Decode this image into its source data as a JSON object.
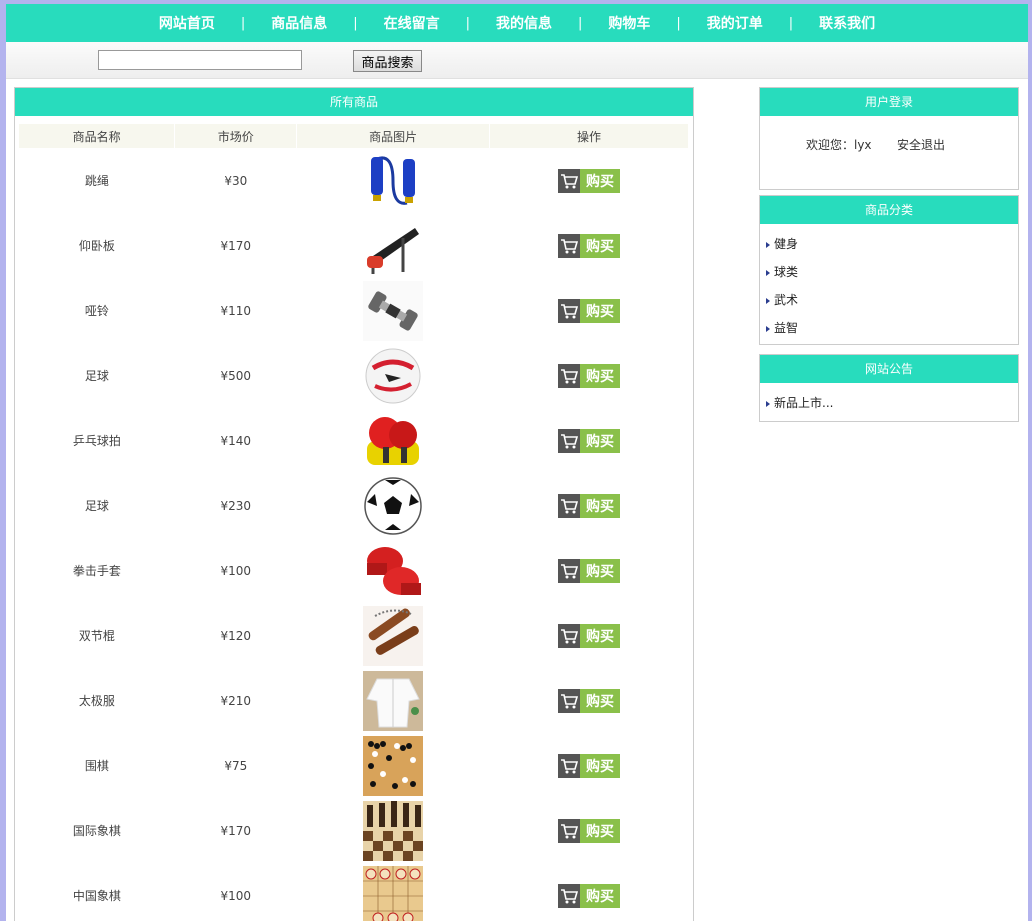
{
  "nav": [
    "网站首页",
    "商品信息",
    "在线留言",
    "我的信息",
    "购物车",
    "我的订单",
    "联系我们"
  ],
  "search": {
    "value": "",
    "button": "商品搜索"
  },
  "goods": {
    "title": "所有商品",
    "headers": [
      "商品名称",
      "市场价",
      "商品图片",
      "操作"
    ],
    "buy_label": "购买",
    "rows": [
      {
        "name": "跳绳",
        "price": "¥30",
        "icon": "jump-rope-image"
      },
      {
        "name": "仰卧板",
        "price": "¥170",
        "icon": "sit-up-bench-image"
      },
      {
        "name": "哑铃",
        "price": "¥110",
        "icon": "dumbbell-image"
      },
      {
        "name": "足球",
        "price": "¥500",
        "icon": "soccer-ball-image"
      },
      {
        "name": "乒乓球拍",
        "price": "¥140",
        "icon": "ping-pong-paddle-image"
      },
      {
        "name": "足球",
        "price": "¥230",
        "icon": "soccer-ball-classic-image"
      },
      {
        "name": "拳击手套",
        "price": "¥100",
        "icon": "boxing-gloves-image"
      },
      {
        "name": "双节棍",
        "price": "¥120",
        "icon": "nunchaku-image"
      },
      {
        "name": "太极服",
        "price": "¥210",
        "icon": "tai-chi-uniform-image"
      },
      {
        "name": "围棋",
        "price": "¥75",
        "icon": "go-board-image"
      },
      {
        "name": "国际象棋",
        "price": "¥170",
        "icon": "chess-image"
      },
      {
        "name": "中国象棋",
        "price": "¥100",
        "icon": "xiangqi-image"
      }
    ]
  },
  "login": {
    "title": "用户登录",
    "welcome": "欢迎您：lyx",
    "logout": "安全退出"
  },
  "categories": {
    "title": "商品分类",
    "items": [
      "健身",
      "球类",
      "武术",
      "益智"
    ]
  },
  "notice": {
    "title": "网站公告",
    "items": [
      "新品上市..."
    ]
  },
  "colors": {
    "header": "#28dcbd",
    "buy": "#8ac04a",
    "background": "#b3b3ee"
  }
}
